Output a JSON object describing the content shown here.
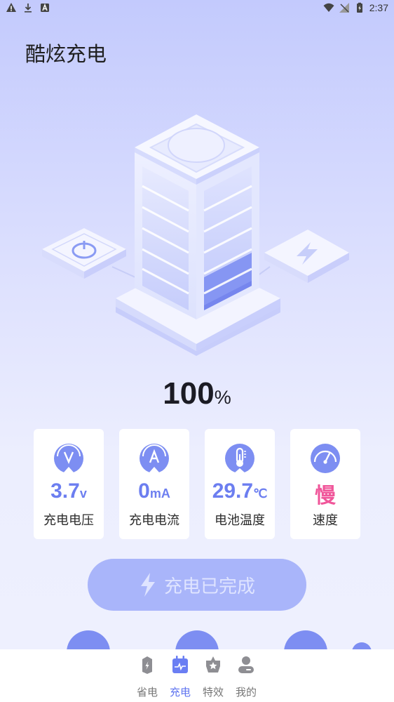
{
  "status_bar": {
    "time": "2:37"
  },
  "header": {
    "title": "酷炫充电"
  },
  "battery": {
    "percent": "100",
    "unit": "%",
    "level": 1.0
  },
  "stats": [
    {
      "value": "3.7",
      "unit": "v",
      "label": "充电电压",
      "icon": "voltmeter-icon"
    },
    {
      "value": "0",
      "unit": "mA",
      "label": "充电电流",
      "icon": "ammeter-icon"
    },
    {
      "value": "29.7",
      "unit": "℃",
      "label": "电池温度",
      "icon": "thermometer-icon"
    },
    {
      "value": "慢",
      "unit": "",
      "label": "速度",
      "icon": "speedometer-icon"
    }
  ],
  "charge_button": {
    "label": "充电已完成"
  },
  "tabs": [
    {
      "label": "省电",
      "icon": "battery-saver-icon",
      "active": false
    },
    {
      "label": "充电",
      "icon": "charging-icon",
      "active": true
    },
    {
      "label": "特效",
      "icon": "star-effect-icon",
      "active": false
    },
    {
      "label": "我的",
      "icon": "profile-icon",
      "active": false
    }
  ],
  "colors": {
    "accent": "#6c7ef0",
    "slow": "#f0569a",
    "button": "#a9b5fa",
    "tab_active": "#5f74f0"
  }
}
